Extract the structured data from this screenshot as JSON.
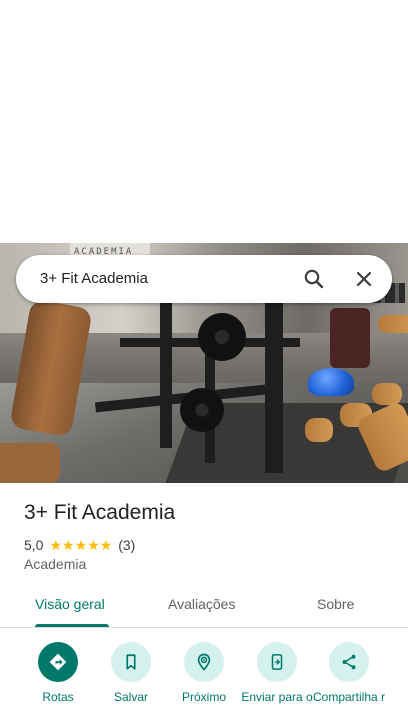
{
  "search": {
    "query": "3+ Fit Academia",
    "search_icon": "search-icon",
    "close_icon": "close-icon"
  },
  "photo": {
    "sign_text": "ACADEMIA"
  },
  "place": {
    "name": "3+ Fit Academia",
    "rating_value": "5,0",
    "stars": "★★★★★",
    "rating_count": "(3)",
    "category": "Academia"
  },
  "tabs": [
    {
      "label": "Visão geral",
      "active": true
    },
    {
      "label": "Avaliações",
      "active": false
    },
    {
      "label": "Sobre",
      "active": false
    }
  ],
  "actions": [
    {
      "label": "Rotas",
      "icon": "directions-icon"
    },
    {
      "label": "Salvar",
      "icon": "bookmark-icon"
    },
    {
      "label": "Próximo",
      "icon": "nearby-icon"
    },
    {
      "label": "Enviar para o",
      "icon": "send-to-phone-icon"
    },
    {
      "label": "Compartilha r",
      "icon": "share-icon"
    }
  ],
  "colors": {
    "accent": "#00796b",
    "accent_light": "#d5f1ee",
    "star": "#fbbc04"
  }
}
